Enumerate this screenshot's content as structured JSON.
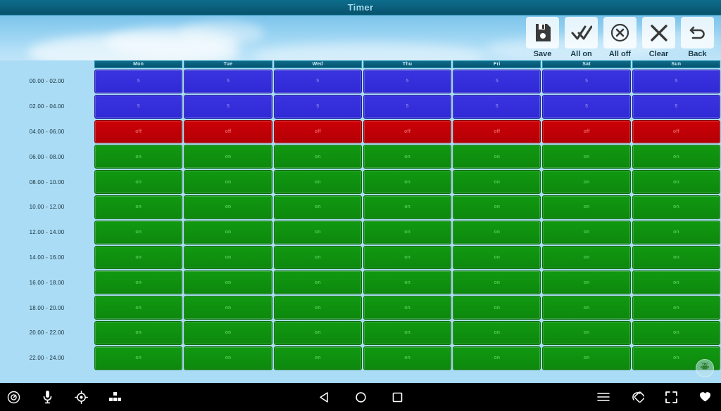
{
  "window": {
    "title": "Timer"
  },
  "toolbar": {
    "buttons": [
      {
        "label": "Save",
        "icon": "floppy-disk-icon"
      },
      {
        "label": "All on",
        "icon": "double-check-icon"
      },
      {
        "label": "All off",
        "icon": "circle-x-icon"
      },
      {
        "label": "Clear",
        "icon": "x-icon"
      },
      {
        "label": "Back",
        "icon": "undo-arrow-icon"
      }
    ]
  },
  "schedule": {
    "days": [
      "Mon",
      "Tue",
      "Wed",
      "Thu",
      "Fri",
      "Sat",
      "Sun"
    ],
    "time_slots": [
      "00.00 - 02.00",
      "02.00 - 04.00",
      "04.00 - 06.00",
      "06.00 - 08.00",
      "08.00 - 10.00",
      "10.00 - 12.00",
      "12.00 - 14.00",
      "14.00 - 16.00",
      "16.00 - 18.00",
      "18.00 - 20.00",
      "20.00 - 22.00",
      "22.00 - 24.00"
    ],
    "state_labels": {
      "blue": "5",
      "red": "off",
      "green": "on"
    },
    "state_colors": {
      "blue": "#2f29d6",
      "red": "#cc0007",
      "green": "#119911"
    },
    "rows": [
      {
        "slot": "00.00 - 02.00",
        "states": [
          "blue",
          "blue",
          "blue",
          "blue",
          "blue",
          "blue",
          "blue"
        ]
      },
      {
        "slot": "02.00 - 04.00",
        "states": [
          "blue",
          "blue",
          "blue",
          "blue",
          "blue",
          "blue",
          "blue"
        ]
      },
      {
        "slot": "04.00 - 06.00",
        "states": [
          "red",
          "red",
          "red",
          "red",
          "red",
          "red",
          "red"
        ]
      },
      {
        "slot": "06.00 - 08.00",
        "states": [
          "green",
          "green",
          "green",
          "green",
          "green",
          "green",
          "green"
        ]
      },
      {
        "slot": "08.00 - 10.00",
        "states": [
          "green",
          "green",
          "green",
          "green",
          "green",
          "green",
          "green"
        ]
      },
      {
        "slot": "10.00 - 12.00",
        "states": [
          "green",
          "green",
          "green",
          "green",
          "green",
          "green",
          "green"
        ]
      },
      {
        "slot": "12.00 - 14.00",
        "states": [
          "green",
          "green",
          "green",
          "green",
          "green",
          "green",
          "green"
        ]
      },
      {
        "slot": "14.00 - 16.00",
        "states": [
          "green",
          "green",
          "green",
          "green",
          "green",
          "green",
          "green"
        ]
      },
      {
        "slot": "16.00 - 18.00",
        "states": [
          "green",
          "green",
          "green",
          "green",
          "green",
          "green",
          "green"
        ]
      },
      {
        "slot": "18.00 - 20.00",
        "states": [
          "green",
          "green",
          "green",
          "green",
          "green",
          "green",
          "green"
        ]
      },
      {
        "slot": "20.00 - 22.00",
        "states": [
          "green",
          "green",
          "green",
          "green",
          "green",
          "green",
          "green"
        ]
      },
      {
        "slot": "22.00 - 24.00",
        "states": [
          "green",
          "green",
          "green",
          "green",
          "green",
          "green",
          "green"
        ]
      }
    ]
  },
  "fab": {
    "icon": "android-robot-icon"
  },
  "navbar": {
    "left": [
      {
        "icon": "power-circle-icon"
      },
      {
        "icon": "microphone-icon"
      },
      {
        "icon": "location-target-icon"
      },
      {
        "icon": "apps-grid-icon"
      }
    ],
    "middle": [
      {
        "icon": "back-triangle-icon"
      },
      {
        "icon": "home-circle-icon"
      },
      {
        "icon": "recents-square-icon"
      }
    ],
    "right": [
      {
        "icon": "menu-hamburger-icon"
      },
      {
        "icon": "rotate-screen-icon"
      },
      {
        "icon": "fullscreen-icon"
      },
      {
        "icon": "heart-icon"
      }
    ]
  }
}
